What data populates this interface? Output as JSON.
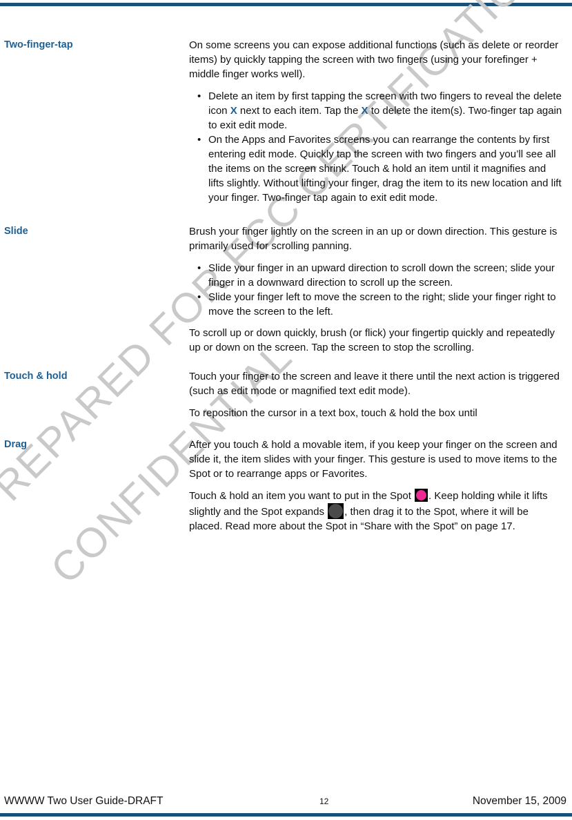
{
  "page": {
    "rule_color": "#1b5179",
    "heading_color": "#1f6094",
    "watermark_color": "#c9c9c9"
  },
  "watermark": {
    "line1": "PREPARED FOR FCC CERTIFICATION",
    "line2": "CONFIDENTIAL"
  },
  "sections": [
    {
      "term": "Two-finger-tap",
      "intro": "On some screens you can expose additional functions (such as delete or reorder items) by quickly tapping the screen with two fingers (using your forefinger + middle finger works well).",
      "bullets": [
        {
          "pre": "Delete an item by first tapping the screen with two fingers to reveal the delete icon ",
          "x1": "X",
          "mid": " next to each item. Tap the ",
          "x2": "X",
          "post": " to delete the item(s). Two-finger tap again to exit edit mode."
        },
        {
          "text": "On the Apps and Favorites screens you can rearrange the contents by first entering edit mode. Quickly tap the screen with two fingers and you’ll see all the items on the screen shrink. Touch & hold an item until it magnifies and lifts slightly. Without lifting your finger, drag the item to its new location and lift your finger. Two-finger tap again to exit edit mode."
        }
      ]
    },
    {
      "term": "Slide",
      "intro": "Brush your finger lightly on the screen in an up or down direction. This gesture is primarily used for scrolling panning.",
      "bullets": [
        {
          "text": "Slide your finger in an upward direction to scroll down the screen; slide your finger in a downward direction to scroll up the screen."
        },
        {
          "text": "Slide your finger left to move the screen to the right; slide your finger right to move the screen to the left."
        }
      ],
      "outro": "To scroll up or down quickly, brush (or flick) your fingertip quickly and repeatedly up or down on the screen. Tap the screen to stop the scrolling."
    },
    {
      "term": "Touch & hold",
      "para1": "Touch your finger to the screen and leave it there until the next action is triggered (such as edit mode or magnified text edit mode).",
      "para2": "To reposition the cursor in a text box, touch & hold the box until"
    },
    {
      "term": "Drag",
      "para1": "After you touch & hold a movable item, if you keep your finger on the screen and slide it, the item slides with your finger. This gesture is used to move items to the Spot or to rearrange apps or Favorites.",
      "para2_a": "Touch & hold an item you want to put in the Spot ",
      "spot_icon_pink": "spot-pink-icon",
      "para2_b": ". Keep holding while it lifts slightly and the Spot expands ",
      "spot_icon_gray": "spot-gray-icon",
      "para2_c": ", then drag it to the Spot, where it will be placed. Read more about the Spot in “Share with the Spot” on page 17."
    }
  ],
  "footer": {
    "left": "WWWW Two User Guide-DRAFT",
    "page_number": "12",
    "right": "November 15, 2009"
  }
}
